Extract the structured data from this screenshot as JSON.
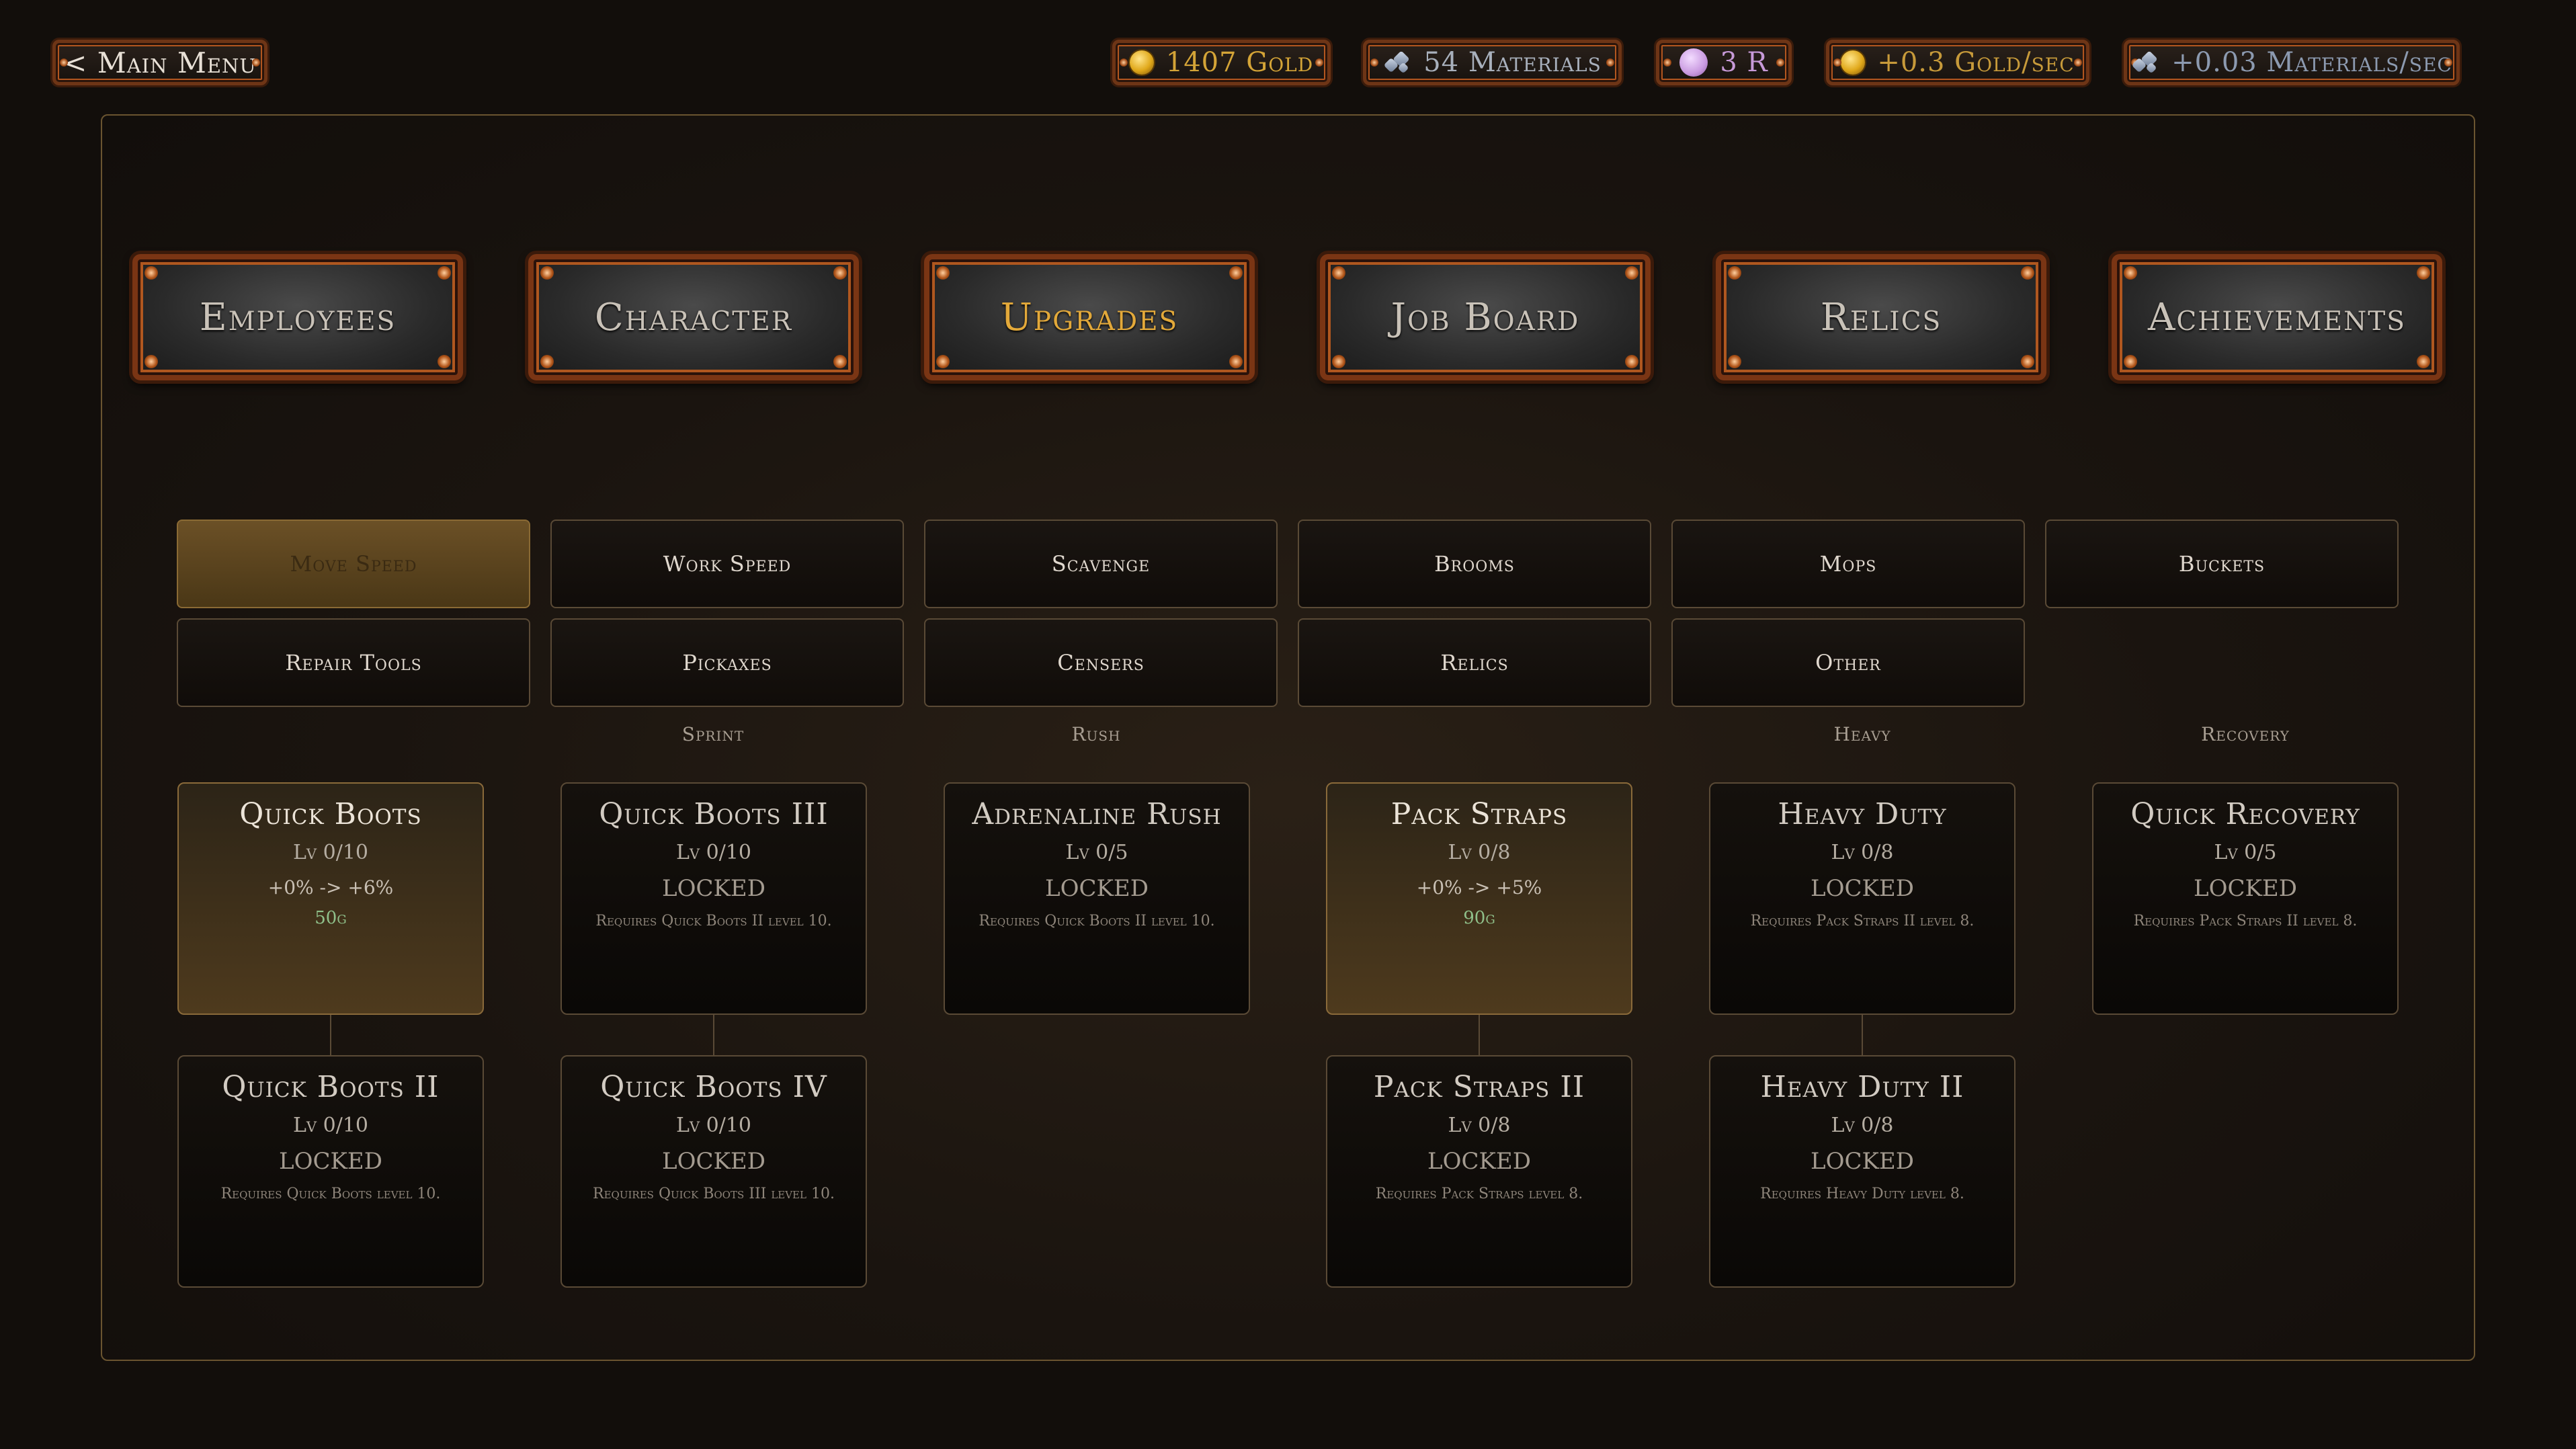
{
  "top_bar": {
    "main_menu_label": "< Main Menu",
    "gold": "1407 Gold",
    "materials": "54 Materials",
    "relic_currency": "3 R",
    "gold_per_sec": "+0.3 Gold/sec",
    "materials_per_sec": "+0.03 Materials/sec"
  },
  "tabs": [
    {
      "label": "Employees",
      "active": false
    },
    {
      "label": "Character",
      "active": false
    },
    {
      "label": "Upgrades",
      "active": true
    },
    {
      "label": "Job Board",
      "active": false
    },
    {
      "label": "Relics",
      "active": false
    },
    {
      "label": "Achievements",
      "active": false
    }
  ],
  "categories": [
    {
      "label": "Move Speed",
      "active": true
    },
    {
      "label": "Work Speed",
      "active": false
    },
    {
      "label": "Scavenge",
      "active": false
    },
    {
      "label": "Brooms",
      "active": false
    },
    {
      "label": "Mops",
      "active": false
    },
    {
      "label": "Buckets",
      "active": false
    },
    {
      "label": "Repair Tools",
      "active": false
    },
    {
      "label": "Pickaxes",
      "active": false
    },
    {
      "label": "Censers",
      "active": false
    },
    {
      "label": "Relics",
      "active": false
    },
    {
      "label": "Other",
      "active": false
    }
  ],
  "groups": {
    "sprint": "Sprint",
    "rush": "Rush",
    "heavy": "Heavy",
    "recovery": "Recovery"
  },
  "upgrades": {
    "quick_boots": {
      "name": "Quick Boots",
      "level": "Lv 0/10",
      "effect": "+0% -> +6%",
      "cost": "50g"
    },
    "quick_boots_2": {
      "name": "Quick Boots II",
      "level": "Lv 0/10",
      "state": "LOCKED",
      "req": "Requires Quick Boots level 10."
    },
    "quick_boots_3": {
      "name": "Quick Boots III",
      "level": "Lv 0/10",
      "state": "LOCKED",
      "req": "Requires Quick Boots II level 10."
    },
    "quick_boots_4": {
      "name": "Quick Boots IV",
      "level": "Lv 0/10",
      "state": "LOCKED",
      "req": "Requires Quick Boots III level 10."
    },
    "adrenaline_rush": {
      "name": "Adrenaline Rush",
      "level": "Lv 0/5",
      "state": "LOCKED",
      "req": "Requires Quick Boots II level 10."
    },
    "pack_straps": {
      "name": "Pack Straps",
      "level": "Lv 0/8",
      "effect": "+0% -> +5%",
      "cost": "90g"
    },
    "pack_straps_2": {
      "name": "Pack Straps II",
      "level": "Lv 0/8",
      "state": "LOCKED",
      "req": "Requires Pack Straps level 8."
    },
    "heavy_duty": {
      "name": "Heavy Duty",
      "level": "Lv 0/8",
      "state": "LOCKED",
      "req": "Requires Pack Straps II level 8."
    },
    "heavy_duty_2": {
      "name": "Heavy Duty II",
      "level": "Lv 0/8",
      "state": "LOCKED",
      "req": "Requires Heavy Duty level 8."
    },
    "quick_recovery": {
      "name": "Quick Recovery",
      "level": "Lv 0/5",
      "state": "LOCKED",
      "req": "Requires Pack Straps II level 8."
    }
  }
}
